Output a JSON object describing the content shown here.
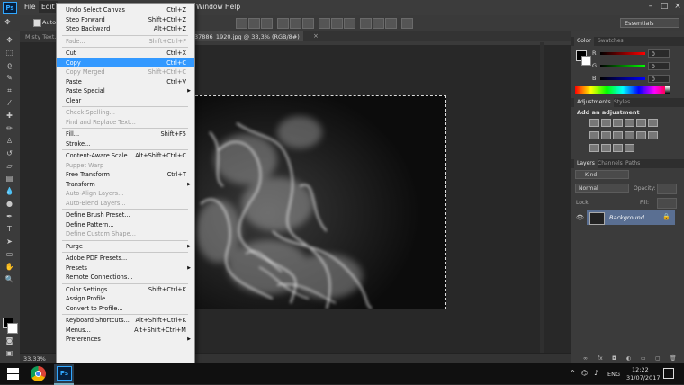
{
  "menubar": {
    "logo": "Ps",
    "items": [
      "File",
      "Edit",
      "Window",
      "Help"
    ]
  },
  "options": {
    "auto_label": "Auto",
    "workspace": "Essentials"
  },
  "tabs": {
    "left": "Misty Text...",
    "active": "37886_1920.jpg @ 33,3% (RGB/8#)"
  },
  "status": {
    "zoom": "33.33%"
  },
  "edit_menu": [
    {
      "label": "Undo Select Canvas",
      "shortcut": "Ctrl+Z",
      "disabled": false
    },
    {
      "label": "Step Forward",
      "shortcut": "Shift+Ctrl+Z",
      "disabled": false
    },
    {
      "label": "Step Backward",
      "shortcut": "Alt+Ctrl+Z",
      "disabled": false
    },
    {
      "sep": true
    },
    {
      "label": "Fade...",
      "shortcut": "Shift+Ctrl+F",
      "disabled": true
    },
    {
      "sep": true
    },
    {
      "label": "Cut",
      "shortcut": "Ctrl+X",
      "disabled": false
    },
    {
      "label": "Copy",
      "shortcut": "Ctrl+C",
      "disabled": false,
      "highlight": true
    },
    {
      "label": "Copy Merged",
      "shortcut": "Shift+Ctrl+C",
      "disabled": true
    },
    {
      "label": "Paste",
      "shortcut": "Ctrl+V",
      "disabled": false
    },
    {
      "label": "Paste Special",
      "submenu": true,
      "disabled": false
    },
    {
      "label": "Clear",
      "disabled": false
    },
    {
      "sep": true
    },
    {
      "label": "Check Spelling...",
      "disabled": true
    },
    {
      "label": "Find and Replace Text...",
      "disabled": true
    },
    {
      "sep": true
    },
    {
      "label": "Fill...",
      "shortcut": "Shift+F5",
      "disabled": false
    },
    {
      "label": "Stroke...",
      "disabled": false
    },
    {
      "sep": true
    },
    {
      "label": "Content-Aware Scale",
      "shortcut": "Alt+Shift+Ctrl+C",
      "disabled": false
    },
    {
      "label": "Puppet Warp",
      "disabled": true
    },
    {
      "label": "Free Transform",
      "shortcut": "Ctrl+T",
      "disabled": false
    },
    {
      "label": "Transform",
      "submenu": true,
      "disabled": false
    },
    {
      "label": "Auto-Align Layers...",
      "disabled": true
    },
    {
      "label": "Auto-Blend Layers...",
      "disabled": true
    },
    {
      "sep": true
    },
    {
      "label": "Define Brush Preset...",
      "disabled": false
    },
    {
      "label": "Define Pattern...",
      "disabled": false
    },
    {
      "label": "Define Custom Shape...",
      "disabled": true
    },
    {
      "sep": true
    },
    {
      "label": "Purge",
      "submenu": true,
      "disabled": false
    },
    {
      "sep": true
    },
    {
      "label": "Adobe PDF Presets...",
      "disabled": false
    },
    {
      "label": "Presets",
      "submenu": true,
      "disabled": false
    },
    {
      "label": "Remote Connections...",
      "disabled": false
    },
    {
      "sep": true
    },
    {
      "label": "Color Settings...",
      "shortcut": "Shift+Ctrl+K",
      "disabled": false
    },
    {
      "label": "Assign Profile...",
      "disabled": false
    },
    {
      "label": "Convert to Profile...",
      "disabled": false
    },
    {
      "sep": true
    },
    {
      "label": "Keyboard Shortcuts...",
      "shortcut": "Alt+Shift+Ctrl+K",
      "disabled": false
    },
    {
      "label": "Menus...",
      "shortcut": "Alt+Shift+Ctrl+M",
      "disabled": false
    },
    {
      "label": "Preferences",
      "submenu": true,
      "disabled": false
    }
  ],
  "color_panel": {
    "tabs": [
      "Color",
      "Swatches"
    ],
    "channels": [
      {
        "name": "R",
        "value": "0",
        "color": "#d22"
      },
      {
        "name": "G",
        "value": "0",
        "color": "#2b2"
      },
      {
        "name": "B",
        "value": "0",
        "color": "#22c"
      }
    ]
  },
  "adjust_panel": {
    "tabs": [
      "Adjustments",
      "Styles"
    ],
    "heading": "Add an adjustment"
  },
  "layers_panel": {
    "tabs": [
      "Layers",
      "Channels",
      "Paths"
    ],
    "kind": "Kind",
    "blend": "Normal",
    "opacity_label": "Opacity:",
    "lock_label": "Lock:",
    "fill_label": "Fill:",
    "layer_name": "Background"
  },
  "taskbar": {
    "lang": "ENG",
    "time": "12:22",
    "date": "31/07/2017"
  }
}
